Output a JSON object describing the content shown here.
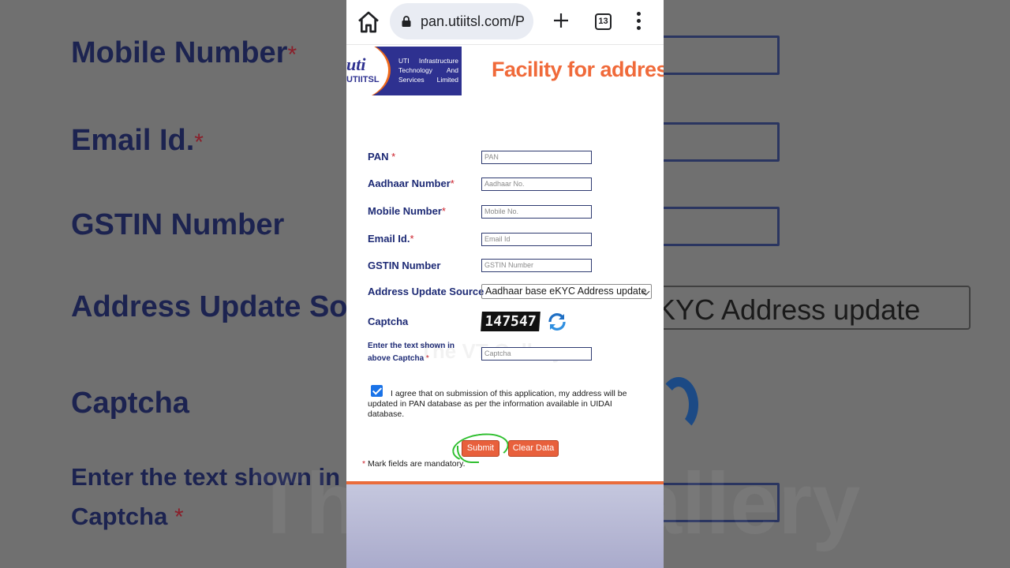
{
  "browser": {
    "url": "pan.utiitsl.com/P",
    "tab_count": "13",
    "icons": [
      "home-icon",
      "lock-icon",
      "plus-icon",
      "tabs-icon",
      "kebab-menu-icon"
    ]
  },
  "header": {
    "logo_uti": "uti",
    "logo_utiitsl": "UTIITSL",
    "logo_company": "UTI Infrastructure Technology And Services Limited",
    "title": "Facility for address"
  },
  "form": {
    "pan_label": "PAN",
    "pan_placeholder": "PAN",
    "aadhaar_label": "Aadhaar Number",
    "aadhaar_placeholder": "Aadhaar No.",
    "mobile_label": "Mobile Number",
    "mobile_placeholder": "Mobile No.",
    "email_label": "Email Id.",
    "email_placeholder": "Email Id",
    "gstin_label": "GSTIN Number",
    "gstin_placeholder": "GSTIN Number",
    "source_label": "Address Update Source",
    "source_value": "Aadhaar base eKYC Address update",
    "captcha_label": "Captcha",
    "captcha_text": "147547",
    "captcha_input_label": "Enter the text shown in above Captcha",
    "captcha_placeholder": "Captcha",
    "required_mark": "*",
    "agree_text": "I agree that on submission of this application, my address will be updated in PAN database as per the information available in UIDAI database.",
    "agree_checked": true,
    "submit_label": "Submit",
    "clear_label": "Clear Data",
    "mandatory_note": "Mark fields are mandatory."
  },
  "watermark": "The VT Gallery",
  "background": {
    "mobile_label": "Mobile Number",
    "email_label": "Email Id.",
    "gstin_label": "GSTIN Number",
    "source_label": "Address Update So",
    "source_value": "KYC Address update",
    "captcha_label": "Captcha",
    "captcha_input_label_1": "Enter the text shown in a",
    "captcha_input_label_2": "Captcha",
    "watermark": "The VT Gallery"
  },
  "colors": {
    "label": "#1d2a75",
    "accent_orange": "#e8603c",
    "required_red": "#cc1f2a",
    "logo_blue": "#2e3190",
    "highlight_green": "#2fbf2f"
  }
}
